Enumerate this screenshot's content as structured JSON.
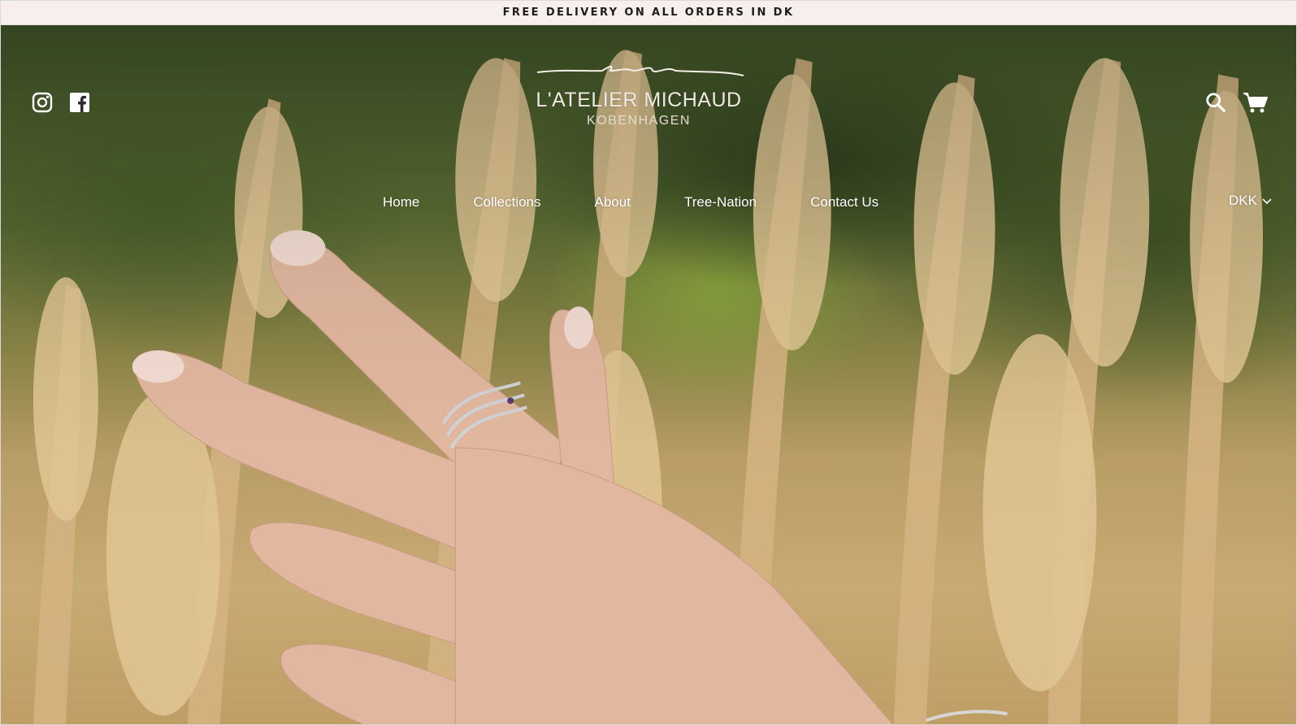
{
  "announcement": {
    "text": "FREE DELIVERY ON ALL ORDERS IN DK"
  },
  "header": {
    "social": [
      {
        "icon": "instagram-icon"
      },
      {
        "icon": "facebook-icon"
      }
    ],
    "logo": {
      "name": "L'ATELIER MICHAUD",
      "subtitle": "KOBENHAGEN"
    },
    "actions": [
      {
        "icon": "search-icon"
      },
      {
        "icon": "cart-icon"
      }
    ]
  },
  "nav": {
    "items": [
      {
        "label": "Home"
      },
      {
        "label": "Collections"
      },
      {
        "label": "About"
      },
      {
        "label": "Tree-Nation"
      },
      {
        "label": "Contact Us"
      }
    ]
  },
  "currency": {
    "selected": "DKK"
  },
  "colors": {
    "announcement_bg": "#f7efec",
    "announcement_text": "#1d1d1d",
    "nav_text": "#ffffff"
  }
}
